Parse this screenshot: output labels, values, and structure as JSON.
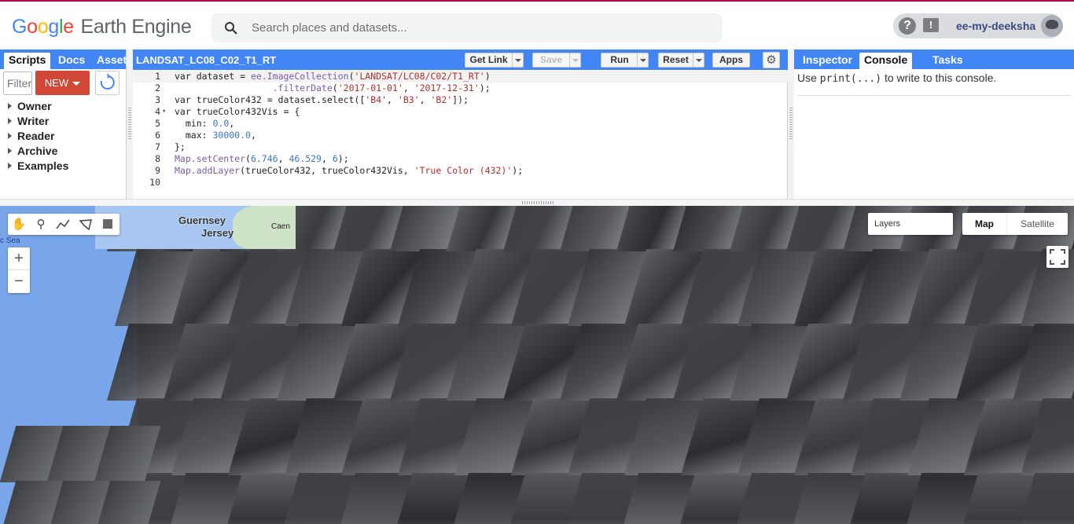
{
  "header": {
    "logo_google": [
      "G",
      "o",
      "o",
      "g",
      "l",
      "e"
    ],
    "logo_product": "Earth Engine",
    "search_placeholder": "Search places and datasets...",
    "help_label": "?",
    "feedback_label": "!",
    "username": "ee-my-deeksha"
  },
  "left_panel": {
    "tabs": [
      "Scripts",
      "Docs",
      "Assets"
    ],
    "active_tab": "Scripts",
    "filter_placeholder": "Filter scripts...",
    "new_label": "NEW",
    "tree": [
      "Owner",
      "Writer",
      "Reader",
      "Archive",
      "Examples"
    ]
  },
  "editor": {
    "script_title": "LANDSAT_LC08_C02_T1_RT",
    "buttons": {
      "get_link": "Get Link",
      "save": "Save",
      "run": "Run",
      "reset": "Reset",
      "apps": "Apps"
    },
    "lines": [
      "var dataset = ee.ImageCollection('LANDSAT/LC08/C02/T1_RT')",
      "                  .filterDate('2017-01-01', '2017-12-31');",
      "var trueColor432 = dataset.select(['B4', 'B3', 'B2']);",
      "var trueColor432Vis = {",
      "  min: 0.0,",
      "  max: 30000.0,",
      "};",
      "Map.setCenter(6.746, 46.529, 6);",
      "Map.addLayer(trueColor432, trueColor432Vis, 'True Color (432)');",
      ""
    ]
  },
  "right_panel": {
    "tabs": [
      "Inspector",
      "Console",
      "Tasks"
    ],
    "active_tab": "Console",
    "console_prefix": "Use ",
    "console_code": "print(...)",
    "console_suffix": " to write to this console."
  },
  "map": {
    "inset_labels": [
      "Guernsey",
      "Jersey",
      "Caen"
    ],
    "sea_label": "c Sea",
    "zoom_in": "+",
    "zoom_out": "−",
    "layers_label": "Layers",
    "map_type_options": [
      "Map",
      "Satellite"
    ],
    "map_type_selected": "Map"
  },
  "colors": {
    "accent": "#4285f4",
    "new_button": "#d14836",
    "top_line": "#b4004e",
    "sea": "#78a6e8"
  },
  "icons": [
    "search-icon",
    "help-icon",
    "feedback-icon",
    "refresh-icon",
    "settings-gear-icon",
    "pan-hand-icon",
    "marker-icon",
    "polyline-icon",
    "polygon-icon",
    "rectangle-icon",
    "fullscreen-icon"
  ]
}
